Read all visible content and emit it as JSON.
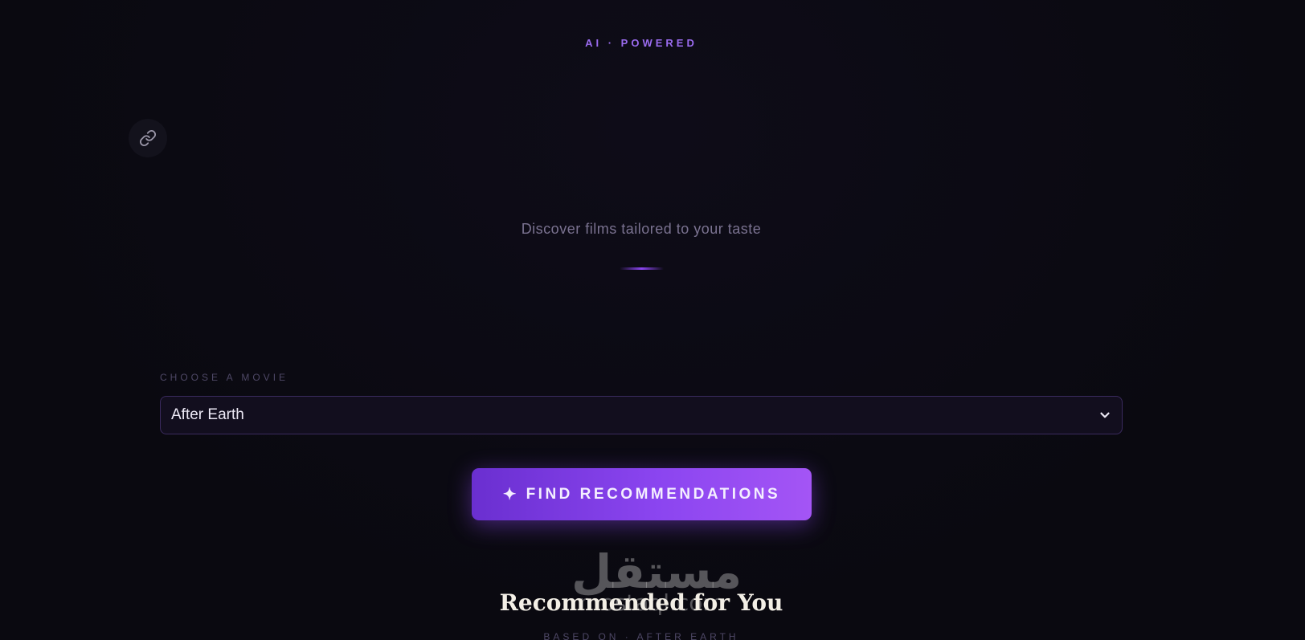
{
  "header": {
    "eyebrow": "AI · POWERED",
    "tagline": "Discover films tailored to your taste"
  },
  "icons": {
    "link": "link-icon",
    "chevron": "chevron-down-icon",
    "sparkle": "sparkle-icon"
  },
  "form": {
    "label": "CHOOSE A MOVIE",
    "selected_movie": "After Earth",
    "submit_label": "FIND RECOMMENDATIONS",
    "submit_glyph": "✦"
  },
  "results": {
    "title": "Recommended for You",
    "based_on": "BASED ON · AFTER EARTH"
  },
  "watermark": {
    "arabic": "مستقل",
    "latin": "mostaql.com"
  },
  "colors": {
    "background": "#0b0a12",
    "accent": "#8b45f0",
    "accent_light": "#a455f5",
    "muted_text": "#7a7290"
  }
}
